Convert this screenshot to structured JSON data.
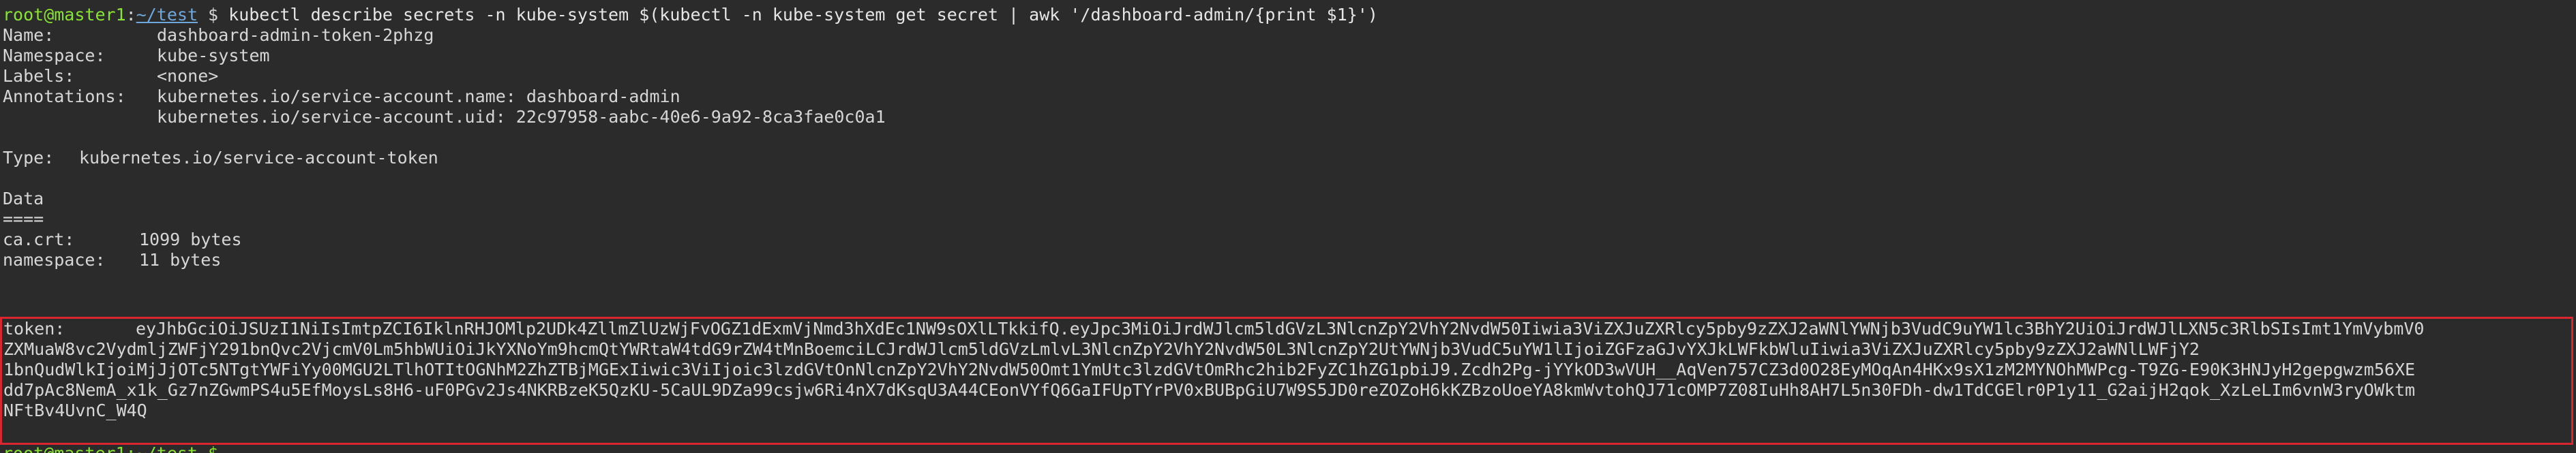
{
  "prompt": {
    "user_host": "root@master1",
    "sep": ":",
    "path": "~/test",
    "dollar": " $ ",
    "command": "kubectl describe secrets -n kube-system $(kubectl -n kube-system get secret | awk '/dashboard-admin/{print $1}')"
  },
  "secret": {
    "name_key": "Name:",
    "name_val": "dashboard-admin-token-2phzg",
    "namespace_key": "Namespace:",
    "namespace_val": "kube-system",
    "labels_key": "Labels:",
    "labels_val": "<none>",
    "annotations_key": "Annotations:",
    "annotation_1": "kubernetes.io/service-account.name: dashboard-admin",
    "annotation_2": "kubernetes.io/service-account.uid: 22c97958-aabc-40e6-9a92-8ca3fae0c0a1",
    "type_key": "Type:",
    "type_val": "kubernetes.io/service-account-token",
    "data_heading": "Data",
    "data_rule": "====",
    "ca_key": "ca.crt:",
    "ca_val": "1099 bytes",
    "ns_key": "namespace:",
    "ns_val": "11 bytes",
    "token_key": "token:",
    "token_lines": [
      "eyJhbGciOiJSUzI1NiIsImtpZCI6IklnRHJOMlp2UDk4ZllmZlUzWjFvOGZ1dExmVjNmd3hXdEc1NW9sOXlLTkkifQ.eyJpc3MiOiJrdWJlcm5ldGVzL3NlcnZpY2VhY2NvdW50Iiwia3ViZXJuZXRlcy5pby9zZXJ2aWNlYWNjb3VudC9uYW1lc3BhY2UiOiJrdWJlLXN5c3RlbSIsImt1YmVybmV0",
      "ZXMuaW8vc2VydmljZWFjY291bnQvc2VjcmV0Lm5hbWUiOiJkYXNoYm9hcmQtYWRtaW4tdG9rZW4tMnBoemciLCJrdWJlcm5ldGVzLmlvL3NlcnZpY2VhY2NvdW50L3NlcnZpY2UtYWNjb3VudC5uYW1lIjoiZGFzaGJvYXJkLWFkbWluIiwia3ViZXJuZXRlcy5pby9zZXJ2aWNlLWFjY2",
      "1bnQudWlkIjoiMjJjOTc5NTgtYWFiYy00MGU2LTlhOTItOGNhM2ZhZTBjMGExIiwic3ViIjoic3lzdGVtOnNlcnZpY2VhY2NvdW50Omt1YmUtc3lzdGVtOmRhc2hib2FyZC1hZG1pbiJ9.Zcdh2Pg-jYYkOD3wVUH__AqVen757CZ3d0O28EyMOqAn4HKx9sX1zM2MYNOhMWPcg-T9ZG-E90K3HNJyH2gepgwzm56XE",
      "dd7pAc8NemA_x1k_Gz7nZGwmPS4u5EfMoysLs8H6-uF0PGv2Js4NKRBzeK5QzKU-5CaUL9DZa99csjw6Ri4nX7dKsqU3A44CEonVYfQ6GaIFUpTYrPV0xBUBpGiU7W9S5JD0reZOZoH6kKZBzoUoeYA8kmWvtohQJ71cOMP7Z08IuHh8AH7L5n30FDh-dw1TdCGElr0P1y11_G2aijH2qok_XzLeLIm6vnW3ryOWktm",
      "NFtBv4UvnC_W4Q"
    ]
  },
  "next_prompt_partial": "root@master1:~/test $"
}
